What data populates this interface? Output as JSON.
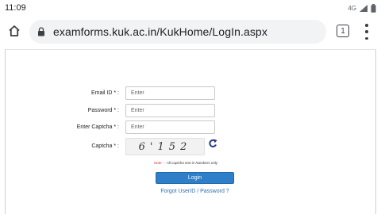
{
  "status_bar": {
    "time": "11:09",
    "network": "4G"
  },
  "browser": {
    "url": "examforms.kuk.ac.in/KukHome/LogIn.aspx",
    "tab_count": "1"
  },
  "form": {
    "email_label": "Email ID * :",
    "email_placeholder": "Enter",
    "password_label": "Password * :",
    "password_placeholder": "Enter",
    "captcha_input_label": "Enter Captcha * :",
    "captcha_input_placeholder": "Enter",
    "captcha_label": "Captcha * :",
    "captcha_text": "6'152",
    "note_prefix": "Note :",
    "note_text": "- All captcha text in Numbers only",
    "login_label": "Login",
    "forgot_label": "Forgot UserID / Password ?"
  },
  "colors": {
    "login_button": "#2e7fc7",
    "link": "#2e6fb0",
    "note_prefix": "#d32f2f"
  }
}
